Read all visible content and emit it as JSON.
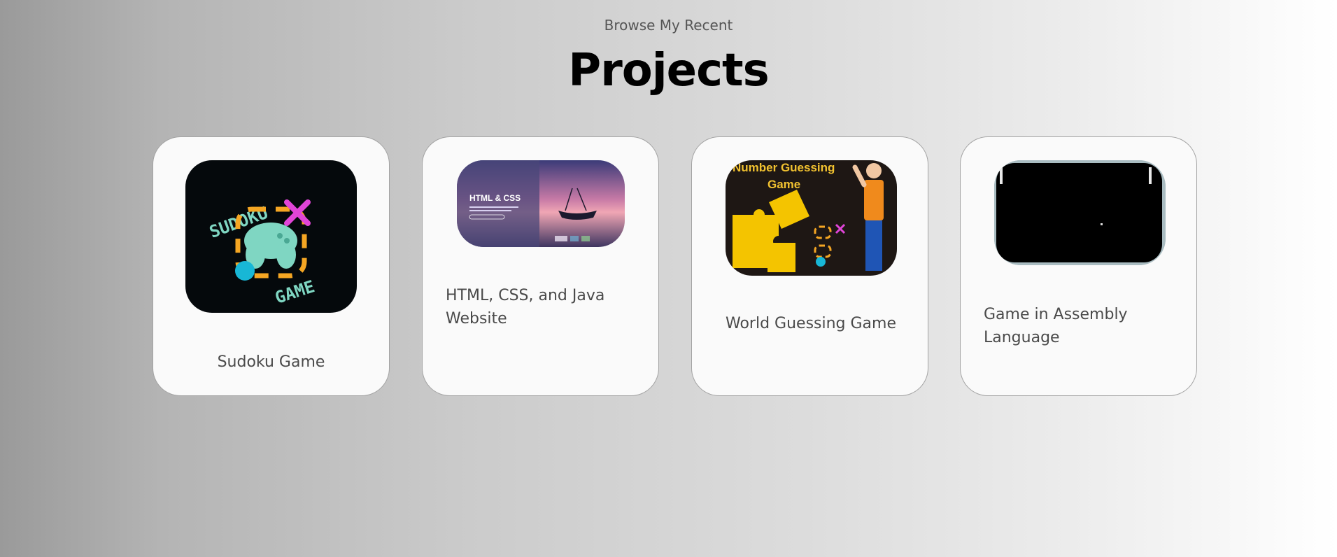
{
  "header": {
    "subtitle": "Browse My Recent",
    "title": "Projects"
  },
  "projects": [
    {
      "name": "Sudoku Game",
      "image": {
        "icon": "sudoku-game-logo",
        "text_top": "SUDOKU",
        "text_bottom": "GAME"
      }
    },
    {
      "name": "HTML, CSS, and Java Website",
      "image": {
        "icon": "website-screenshot",
        "text": "HTML & CSS"
      }
    },
    {
      "name": "World Guessing Game",
      "image": {
        "icon": "number-guessing-game-banner",
        "text_line1": "Number Guessing",
        "text_line2": "Game"
      }
    },
    {
      "name": "Game in Assembly Language",
      "image": {
        "icon": "pong-game-screenshot"
      }
    }
  ],
  "colors": {
    "card_bg": "#fafafa",
    "card_border": "#a3a3a3",
    "text": "#4a4a4a"
  }
}
